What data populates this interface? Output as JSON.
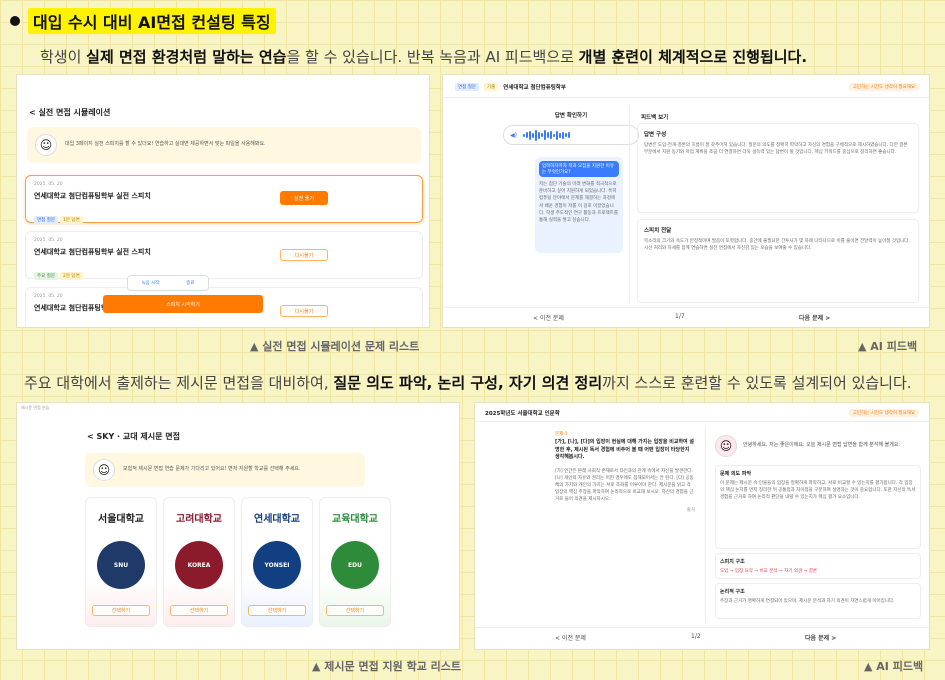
{
  "heading": "대입 수시 대비 AI면접 컨설팅 특징",
  "line1": {
    "a": "학생이 ",
    "b": "실제 면접 환경처럼 말하는 연습",
    "c": "을 할 수 있습니다. 반복 녹음과 AI 피드백으로 ",
    "d": "개별 훈련이 체계적으로 진행됩니다."
  },
  "sim": {
    "back": "< 실전 면접 시뮬레이션",
    "notice": "대입 3페이지 실전 스피치를 할 수 있더요! 연습하고 실대면 제공하면서 맞는 파일을 사용해봐요.",
    "items": [
      {
        "date": "2025. 05. 20",
        "title": "연세대학교 첨단컴퓨팅학부 실전 스피치",
        "tags": [
          "면접 질문",
          "1분 답변"
        ],
        "btn": "실전 풀기"
      },
      {
        "date": "2025. 05. 20",
        "title": "연세대학교 첨단컴퓨팅학부 실전 스피치",
        "tags": [
          "주요 질문",
          "2분 답변"
        ],
        "btn": "다시풀기"
      },
      {
        "date": "2025. 05. 20",
        "title": "연세대학교 첨단컴퓨팅학부 실전 스피치",
        "tags": [],
        "btn": "다시풀기"
      }
    ],
    "popup_a": "녹음 시작",
    "popup_b": "종료",
    "popup_btn": "스피치 시작하기"
  },
  "caption1": "▲ 실전 면접 시뮬레이션 문제 리스트",
  "fb1": {
    "tag1": "면접 질문",
    "tag2": "기출",
    "title": "연세대학교 첨단컴퓨팅학부",
    "badge": "고민하는 시간도 생각이 필요해요",
    "left_title": "답변 확인하기",
    "bubble": "입학하자마자 학과 모집을 지원한 이유는 무엇인가요?",
    "answer": "저는 첨단 기술의 미래 변화를 적극적으로 준비하고 싶어 지원하게 되었습니다. 특히 컴퓨팅 분야에서 문제를 해결하는 과정에서 배운 경험이 저를 이 길로 이끌었습니다. 학생 주도적인 연구 활동과 프로젝트를 통해 실력을 쌓고 싶습니다.",
    "right_title": "피드백 보기",
    "s1_title": "답변 구성",
    "s1_text": "답변은 도입-전개-결론의 흐름이 잘 갖추어져 있습니다. 질문의 의도를 정확히 파악하고 자신의 경험을 구체적으로 제시하였습니다. 다만 결론 부분에서 지원 동기와 학업 계획을 조금 더 연결하면 더욱 설득력 있는 답변이 될 것입니다. 핵심 키워드를 중심으로 정리하면 좋습니다.",
    "s2_title": "스피치 전달",
    "s2_text": "목소리의 크기와 속도가 안정적이며 발음이 또렷합니다. 중간에 불필요한 간투사가 몇 차례 나타나므로 이를 줄이면 전달력이 높아질 것입니다. 시선 처리와 자세를 함께 연습하면 실전 면접에서 자신감 있는 모습을 보여줄 수 있습니다.",
    "prev": "< 이전 문제",
    "page": "1/7",
    "next": "다음 문제 >"
  },
  "caption2": "▲ AI 피드백",
  "line2": {
    "a": "주요 대학에서 출제하는 제시문 면접을 대비하여, ",
    "b": "질문 의도 파악, 논리 구성, 자기 의견 정리",
    "c": "까지 스스로 훈련할 수 있도록 설계되어 있습니다."
  },
  "sky": {
    "crumb": "제시문 면접 연습",
    "back": "< SKY · 교대 제시문 면접",
    "notice": "모험적 제시문 면접 연습 문제가 기다리고 있어요! 면저 지원할 학교를 선택해 주세요.",
    "schools": [
      {
        "name": "서울대학교",
        "color": "#1f3a68",
        "seal": "SNU",
        "btn": "선택하기"
      },
      {
        "name": "고려대학교",
        "color": "#8b1a2b",
        "seal": "KOREA",
        "btn": "선택하기"
      },
      {
        "name": "연세대학교",
        "color": "#123f82",
        "seal": "YONSEI",
        "btn": "선택하기"
      },
      {
        "name": "교육대학교",
        "color": "#2e8b3a",
        "seal": "EDU",
        "btn": "선택하기"
      }
    ]
  },
  "caption3": "▲ 제시문 면접 지원 학교 리스트",
  "fb2": {
    "title": "2025학년도 서울대학교 인문학",
    "badge": "고민하는 시간도 생각이 필요해요",
    "q_label": "문제 1",
    "question": "[가], [나], [다]의 입장이 현실에 대해 가지는 입장을 비교하여 설명한 후, 제시된 독서 경험에 비추어 볼 때 어떤 입장이 타당한지 생각해봅시다.",
    "passage": "[가] 인간은 본래 사회적 존재로서 타인과의 관계 속에서 자신을 발견한다. [나] 개인의 자유와 권리는 어떤 경우에도 침해되어서는 안 된다. [다] 공동체의 가치와 개인의 가치는 서로 조화를 이루어야 한다. 제시문을 읽고 각 입장의 핵심 주장을 파악하여 논리적으로 비교해 보시오. 자신의 경험을 근거로 들어 의견을 제시하시오.",
    "source": "출처",
    "greet": "안녕하세요, 저는 좋은이에요. 오늘 제시문 면접 답변을 함께 분석해 볼게요.",
    "r1_title": "문제 의도 파악",
    "r1_text": "이 문제는 제시문 속 인물들의 입장을 정확하게 파악하고, 서로 비교할 수 있는지를 평가합니다. 각 입장의 핵심 논지를 먼저 정리한 뒤 공통점과 차이점을 구분하여 설명하는 것이 중요합니다. 또한 자신의 독서 경험을 근거로 하여 논리적 판단을 내릴 수 있는지가 핵심 평가 요소입니다.",
    "r2_title": "스피치 구조",
    "r2_text": "도입 → 입장 요약 → 비교 분석 → 자기 의견 → 결론",
    "r3_title": "논리적 구조",
    "r3_text": "주장과 근거가 명확하게 연결되어 있으며, 제시문 분석과 자기 의견이 자연스럽게 이어집니다.",
    "prev": "< 이전 문제",
    "page": "1/2",
    "next": "다음 문제 >"
  },
  "caption4": "▲ AI 피드백"
}
